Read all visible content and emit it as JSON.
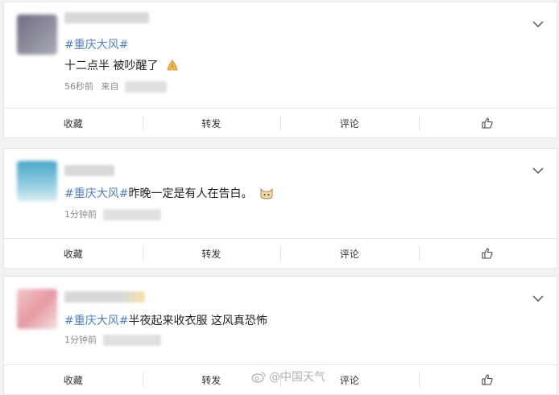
{
  "posts": [
    {
      "hashtag": "#重庆大风#",
      "text": "十二点半 被吵醒了",
      "time": "56秒前",
      "source_prefix": "来自",
      "actions": [
        "收藏",
        "转发",
        "评论"
      ]
    },
    {
      "hashtag": "#重庆大风#",
      "text": "昨晚一定是有人在告白。",
      "time": "1分钟前",
      "source_prefix": "",
      "actions": [
        "收藏",
        "转发",
        "评论"
      ]
    },
    {
      "hashtag": "#重庆大风#",
      "text": "半夜起来收衣服 这风真恐怖",
      "time": "1分钟前",
      "source_prefix": "",
      "actions": [
        "收藏",
        "转发",
        "评论"
      ]
    }
  ],
  "watermark": "@中国天气",
  "icons": {
    "menu": "chevron-down-icon",
    "like": "thumbs-up-icon",
    "emoji1": "praying-hands-emoji-icon",
    "emoji2": "cat-face-emoji-icon",
    "logo": "weibo-logo-icon"
  },
  "colors": {
    "hashtag": "#5081c0",
    "background": "#f2f2f2"
  }
}
